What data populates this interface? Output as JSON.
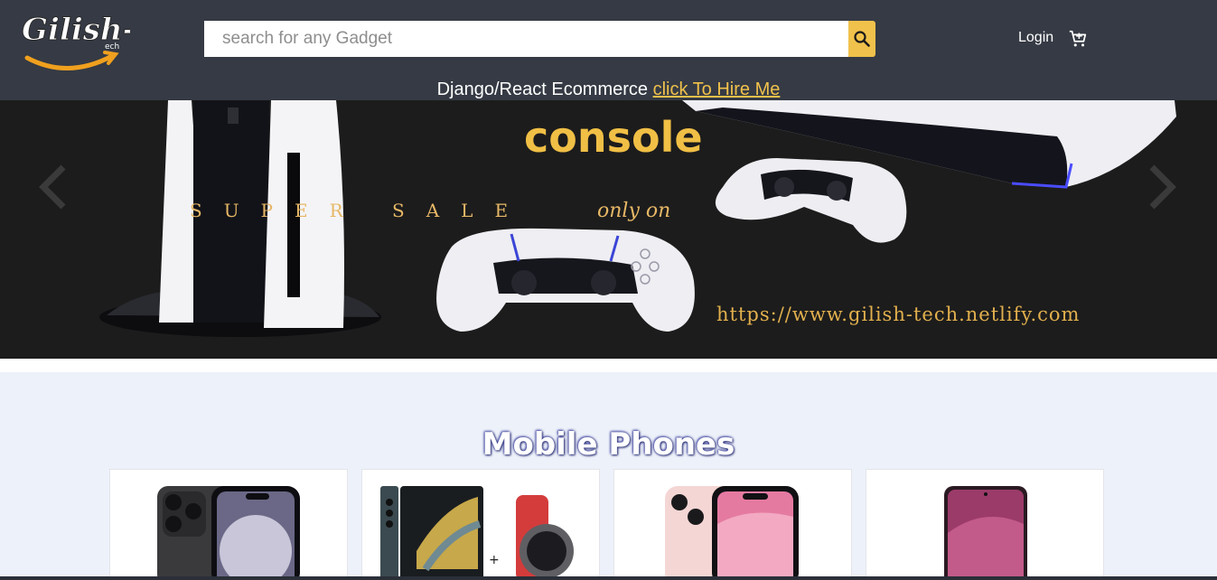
{
  "header": {
    "logo_text": "Gilish-Tech",
    "search": {
      "placeholder": "search for any Gadget",
      "value": ""
    },
    "search_icon": "magnifier-icon",
    "login_label": "Login",
    "cart_icon": "cart-icon",
    "promo_text": "Django/React Ecommerce ",
    "promo_link": "click To Hire Me"
  },
  "banner": {
    "headline": "console",
    "tagline": "SUPER SALE",
    "only_on": "only on",
    "url": "https://www.gilish-tech.netlify.com",
    "prev_icon": "chevron-left-icon",
    "next_icon": "chevron-right-icon"
  },
  "products_section": {
    "title": "Mobile Phones",
    "cards": [
      {
        "image": "iphone-14-pro-image"
      },
      {
        "image": "galaxy-fold-watch-image"
      },
      {
        "image": "iphone-13-pink-image"
      },
      {
        "image": "pink-android-phone-image"
      }
    ]
  },
  "colors": {
    "header_bg": "#353a44",
    "accent": "#f0c14b",
    "banner_bg": "#1c1c1c",
    "section_bg": "#edf1f9"
  }
}
